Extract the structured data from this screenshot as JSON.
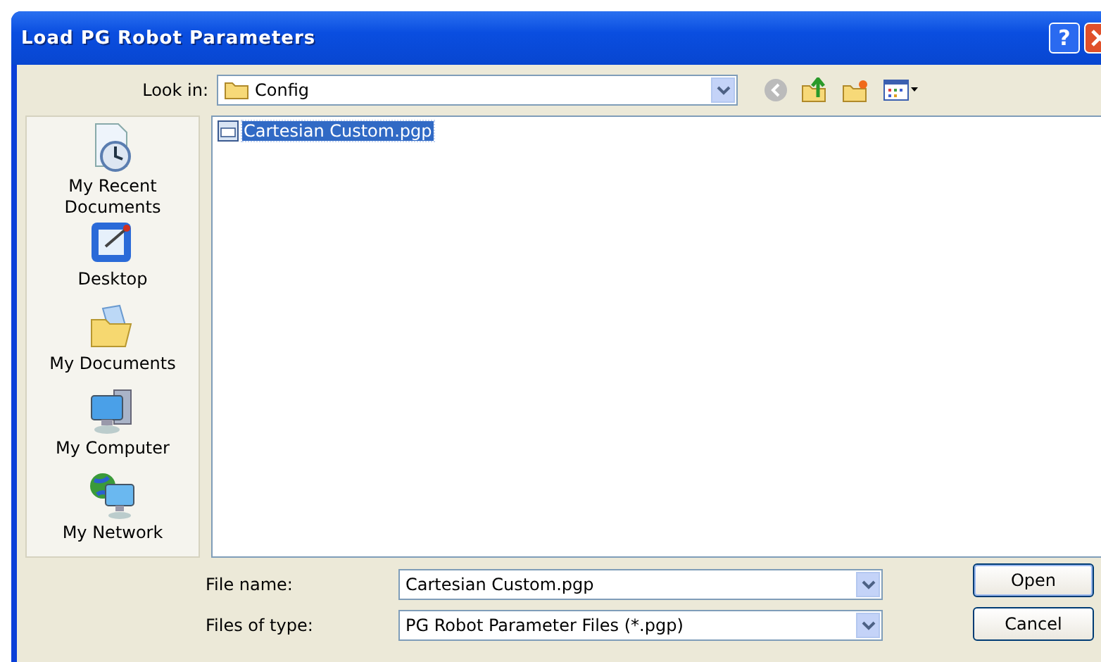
{
  "window": {
    "title": "Load PG Robot Parameters",
    "title_buttons": [
      "?"
    ]
  },
  "look_in": {
    "label": "Look in:",
    "value": "Config"
  },
  "places": [
    {
      "label": "My Recent Documents",
      "kind": "recent"
    },
    {
      "label": "Desktop",
      "kind": "desktop"
    },
    {
      "label": "My Documents",
      "kind": "documents"
    },
    {
      "label": "My Computer",
      "kind": "computer"
    },
    {
      "label": "My Network",
      "kind": "network"
    }
  ],
  "files": [
    {
      "name": "Cartesian Custom.pgp",
      "selected": true
    }
  ],
  "file_name": {
    "label": "File name:",
    "value": "Cartesian Custom.pgp"
  },
  "file_type": {
    "label": "Files of type:",
    "value": "PG Robot Parameter Files (*.pgp)"
  },
  "buttons": [
    "Open",
    "Cancel"
  ]
}
